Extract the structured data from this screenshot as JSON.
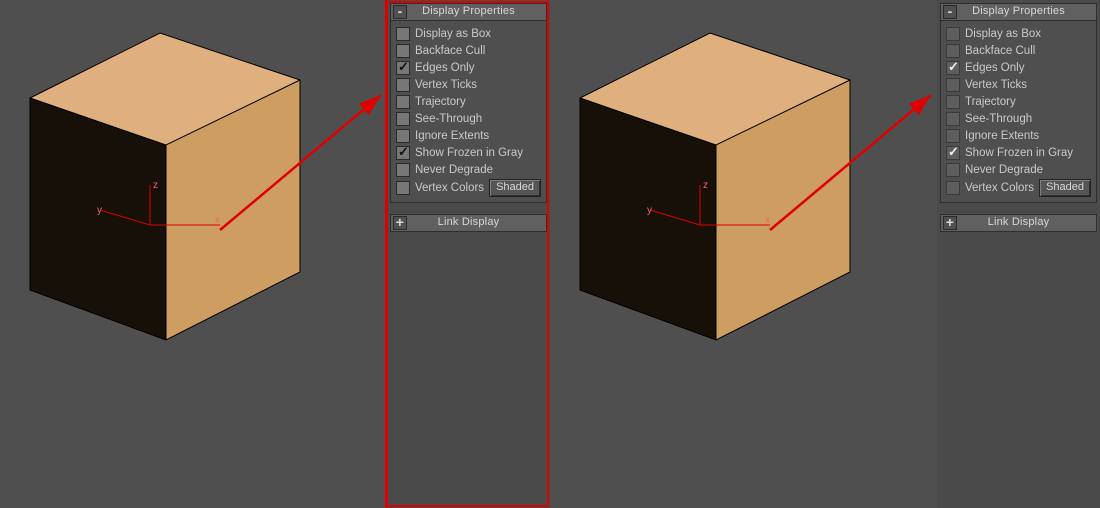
{
  "panels": {
    "display_properties": {
      "title": "Display Properties",
      "toggle": "-",
      "options": [
        {
          "key": "display_as_box",
          "label": "Display as Box",
          "checked": false
        },
        {
          "key": "backface_cull",
          "label": "Backface Cull",
          "checked": false
        },
        {
          "key": "edges_only",
          "label": "Edges Only",
          "checked": true
        },
        {
          "key": "vertex_ticks",
          "label": "Vertex Ticks",
          "checked": false
        },
        {
          "key": "trajectory",
          "label": "Trajectory",
          "checked": false
        },
        {
          "key": "see_through",
          "label": "See-Through",
          "checked": false
        },
        {
          "key": "ignore_extents",
          "label": "Ignore Extents",
          "checked": false
        },
        {
          "key": "show_frozen_gray",
          "label": "Show Frozen in Gray",
          "checked": true
        },
        {
          "key": "never_degrade",
          "label": "Never Degrade",
          "checked": false
        },
        {
          "key": "vertex_colors",
          "label": "Vertex Colors",
          "checked": false
        }
      ],
      "shaded_button": "Shaded"
    },
    "link_display": {
      "title": "Link Display",
      "toggle": "+"
    }
  },
  "axes": {
    "x": "x",
    "y": "y",
    "z": "z"
  }
}
